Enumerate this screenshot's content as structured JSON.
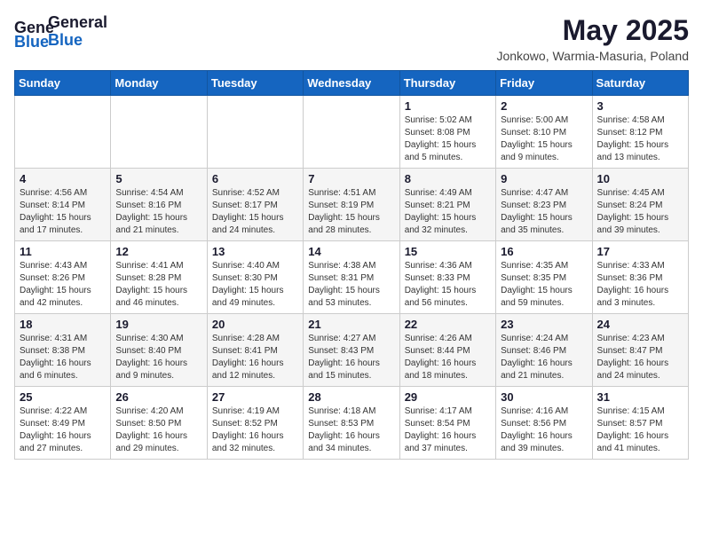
{
  "header": {
    "logo_general": "General",
    "logo_blue": "Blue",
    "month_title": "May 2025",
    "location": "Jonkowo, Warmia-Masuria, Poland"
  },
  "days_of_week": [
    "Sunday",
    "Monday",
    "Tuesday",
    "Wednesday",
    "Thursday",
    "Friday",
    "Saturday"
  ],
  "weeks": [
    [
      {
        "day": "",
        "info": ""
      },
      {
        "day": "",
        "info": ""
      },
      {
        "day": "",
        "info": ""
      },
      {
        "day": "",
        "info": ""
      },
      {
        "day": "1",
        "info": "Sunrise: 5:02 AM\nSunset: 8:08 PM\nDaylight: 15 hours\nand 5 minutes."
      },
      {
        "day": "2",
        "info": "Sunrise: 5:00 AM\nSunset: 8:10 PM\nDaylight: 15 hours\nand 9 minutes."
      },
      {
        "day": "3",
        "info": "Sunrise: 4:58 AM\nSunset: 8:12 PM\nDaylight: 15 hours\nand 13 minutes."
      }
    ],
    [
      {
        "day": "4",
        "info": "Sunrise: 4:56 AM\nSunset: 8:14 PM\nDaylight: 15 hours\nand 17 minutes."
      },
      {
        "day": "5",
        "info": "Sunrise: 4:54 AM\nSunset: 8:16 PM\nDaylight: 15 hours\nand 21 minutes."
      },
      {
        "day": "6",
        "info": "Sunrise: 4:52 AM\nSunset: 8:17 PM\nDaylight: 15 hours\nand 24 minutes."
      },
      {
        "day": "7",
        "info": "Sunrise: 4:51 AM\nSunset: 8:19 PM\nDaylight: 15 hours\nand 28 minutes."
      },
      {
        "day": "8",
        "info": "Sunrise: 4:49 AM\nSunset: 8:21 PM\nDaylight: 15 hours\nand 32 minutes."
      },
      {
        "day": "9",
        "info": "Sunrise: 4:47 AM\nSunset: 8:23 PM\nDaylight: 15 hours\nand 35 minutes."
      },
      {
        "day": "10",
        "info": "Sunrise: 4:45 AM\nSunset: 8:24 PM\nDaylight: 15 hours\nand 39 minutes."
      }
    ],
    [
      {
        "day": "11",
        "info": "Sunrise: 4:43 AM\nSunset: 8:26 PM\nDaylight: 15 hours\nand 42 minutes."
      },
      {
        "day": "12",
        "info": "Sunrise: 4:41 AM\nSunset: 8:28 PM\nDaylight: 15 hours\nand 46 minutes."
      },
      {
        "day": "13",
        "info": "Sunrise: 4:40 AM\nSunset: 8:30 PM\nDaylight: 15 hours\nand 49 minutes."
      },
      {
        "day": "14",
        "info": "Sunrise: 4:38 AM\nSunset: 8:31 PM\nDaylight: 15 hours\nand 53 minutes."
      },
      {
        "day": "15",
        "info": "Sunrise: 4:36 AM\nSunset: 8:33 PM\nDaylight: 15 hours\nand 56 minutes."
      },
      {
        "day": "16",
        "info": "Sunrise: 4:35 AM\nSunset: 8:35 PM\nDaylight: 15 hours\nand 59 minutes."
      },
      {
        "day": "17",
        "info": "Sunrise: 4:33 AM\nSunset: 8:36 PM\nDaylight: 16 hours\nand 3 minutes."
      }
    ],
    [
      {
        "day": "18",
        "info": "Sunrise: 4:31 AM\nSunset: 8:38 PM\nDaylight: 16 hours\nand 6 minutes."
      },
      {
        "day": "19",
        "info": "Sunrise: 4:30 AM\nSunset: 8:40 PM\nDaylight: 16 hours\nand 9 minutes."
      },
      {
        "day": "20",
        "info": "Sunrise: 4:28 AM\nSunset: 8:41 PM\nDaylight: 16 hours\nand 12 minutes."
      },
      {
        "day": "21",
        "info": "Sunrise: 4:27 AM\nSunset: 8:43 PM\nDaylight: 16 hours\nand 15 minutes."
      },
      {
        "day": "22",
        "info": "Sunrise: 4:26 AM\nSunset: 8:44 PM\nDaylight: 16 hours\nand 18 minutes."
      },
      {
        "day": "23",
        "info": "Sunrise: 4:24 AM\nSunset: 8:46 PM\nDaylight: 16 hours\nand 21 minutes."
      },
      {
        "day": "24",
        "info": "Sunrise: 4:23 AM\nSunset: 8:47 PM\nDaylight: 16 hours\nand 24 minutes."
      }
    ],
    [
      {
        "day": "25",
        "info": "Sunrise: 4:22 AM\nSunset: 8:49 PM\nDaylight: 16 hours\nand 27 minutes."
      },
      {
        "day": "26",
        "info": "Sunrise: 4:20 AM\nSunset: 8:50 PM\nDaylight: 16 hours\nand 29 minutes."
      },
      {
        "day": "27",
        "info": "Sunrise: 4:19 AM\nSunset: 8:52 PM\nDaylight: 16 hours\nand 32 minutes."
      },
      {
        "day": "28",
        "info": "Sunrise: 4:18 AM\nSunset: 8:53 PM\nDaylight: 16 hours\nand 34 minutes."
      },
      {
        "day": "29",
        "info": "Sunrise: 4:17 AM\nSunset: 8:54 PM\nDaylight: 16 hours\nand 37 minutes."
      },
      {
        "day": "30",
        "info": "Sunrise: 4:16 AM\nSunset: 8:56 PM\nDaylight: 16 hours\nand 39 minutes."
      },
      {
        "day": "31",
        "info": "Sunrise: 4:15 AM\nSunset: 8:57 PM\nDaylight: 16 hours\nand 41 minutes."
      }
    ]
  ]
}
